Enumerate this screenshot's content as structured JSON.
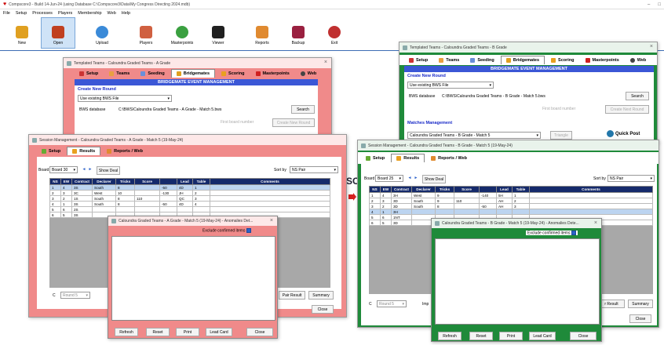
{
  "app": {
    "title": "Compscore3 - Build 14-Jun-24 (using Database C:\\Compscore3\\Data\\My Congress Directing 2024.mdb)",
    "window_controls": [
      "–",
      "□"
    ],
    "menu": [
      "File",
      "Setup",
      "Processes",
      "Players",
      "Membership",
      "Web",
      "Help"
    ],
    "toolbar": [
      {
        "label": "New",
        "icon": "new-icon",
        "color": "#e0a020"
      },
      {
        "label": "Open",
        "icon": "open-folder-icon",
        "color": "#c04020"
      },
      {
        "label": "Upload",
        "icon": "upload-cloud-icon",
        "color": "#3a8ad8"
      },
      {
        "label": "Players",
        "icon": "players-icon",
        "color": "#d06040"
      },
      {
        "label": "Masterpoints",
        "icon": "masterpoints-icon",
        "color": "#3aa040"
      },
      {
        "label": "Viewer",
        "icon": "viewer-icon",
        "color": "#202020"
      },
      {
        "label": "Reports",
        "icon": "reports-icon",
        "color": "#e08a30"
      },
      {
        "label": "Backup",
        "icon": "backup-icon",
        "color": "#9a2040"
      },
      {
        "label": "Exit",
        "icon": "exit-icon",
        "color": "#c03030"
      }
    ]
  },
  "colors": {
    "pink": "#f08a8a",
    "green": "#1f8a3a",
    "header_navy": "#152a6b",
    "bar_blue": "#3b57d6"
  },
  "templA": {
    "title": "Templated Teams - Caloundra Graded Teams - A Grade",
    "tabs": [
      "Setup",
      "Teams",
      "Seeding",
      "Bridgemates",
      "Scoring",
      "Masterpoints",
      "Web"
    ],
    "banner": "BRIDGEMATE EVENT MANAGEMENT",
    "create_heading": "Create New Round",
    "bws_select": "Use existing BWS File",
    "bws_label": "BWS database",
    "bws_path": "C:\\BWS\\Caloundra Graded Teams - A Grade - Match 5.bws",
    "search": "Search",
    "first_board": "First board number",
    "create_round": "Create New Round"
  },
  "templB": {
    "title": "Templated Teams - Caloundra Graded Teams - B Grade",
    "tabs": [
      "Setup",
      "Teams",
      "Seeding",
      "Bridgemates",
      "Scoring",
      "Masterpoints",
      "Web"
    ],
    "banner": "BRIDGEMATE EVENT MANAGEMENT",
    "create_heading": "Create New Round",
    "bws_select": "Use existing BWS File",
    "bws_label": "BWS database",
    "bws_path": "C:\\BWS\\Caloundra Graded Teams - B Grade - Match 5.bws",
    "search": "Search",
    "first_board": "First board number",
    "create_round": "Create Next Round",
    "matches_heading": "Matches Management",
    "match_select": "Caloundra Graded Teams - B Grade - Match 5",
    "triangle": "Triangle",
    "quick_post": "Quick Post"
  },
  "sessA": {
    "title": "Session Management - Caloundra Graded Teams - A Grade - Match 5 (19-May-24)",
    "tabs": [
      "Setup",
      "Results",
      "Reports / Web"
    ],
    "board_label": "Board",
    "board_value": "Board 30",
    "show_deal": "Show Deal",
    "sortby_label": "Sort by",
    "sortby_value": "NS Pair",
    "headers": [
      "NS",
      "EW",
      "Contract",
      "Declarer",
      "Tricks",
      "Score",
      "",
      "Lead",
      "Table",
      "Comments"
    ],
    "rows": [
      [
        "1",
        "4",
        "3S",
        "South",
        "8",
        "",
        "-50",
        "4D",
        "1",
        ""
      ],
      [
        "2",
        "3",
        "3C",
        "West",
        "10",
        "",
        "-130",
        "JH",
        "2",
        ""
      ],
      [
        "3",
        "2",
        "1S",
        "South",
        "8",
        "110",
        "",
        "QC",
        "3",
        ""
      ],
      [
        "4",
        "1",
        "3S",
        "South",
        "8",
        "",
        "-50",
        "4D",
        "4",
        ""
      ],
      [
        "5",
        "6",
        "2S",
        "",
        "",
        "",
        "",
        "",
        "",
        ""
      ],
      [
        "6",
        "5",
        "3S",
        "",
        "",
        "",
        "",
        "",
        "",
        ""
      ]
    ],
    "round_label": "C",
    "round_value": "Round 5",
    "pair_result": "Pair Result",
    "summary": "Summary",
    "close": "Close"
  },
  "sessB": {
    "title": "Session Management - Caloundra Graded Teams - B Grade - Match 5 (19-May-24)",
    "tabs": [
      "Setup",
      "Results",
      "Reports / Web"
    ],
    "board_label": "Board",
    "board_value": "Board 25",
    "show_deal": "Show Deal",
    "sortby_label": "Sort by",
    "sortby_value": "NS Pair",
    "headers": [
      "NS",
      "EW",
      "Contract",
      "Declarer",
      "Tricks",
      "Score",
      "",
      "Lead",
      "Table",
      "Comments"
    ],
    "rows": [
      [
        "1",
        "4",
        "3H",
        "West",
        "9",
        "",
        "-140",
        "5H",
        "1",
        ""
      ],
      [
        "2",
        "3",
        "3D",
        "South",
        "9",
        "110",
        "",
        "AH",
        "2",
        ""
      ],
      [
        "3",
        "2",
        "3D",
        "South",
        "8",
        "",
        "-50",
        "AH",
        "3",
        ""
      ],
      [
        "4",
        "1",
        "3H",
        "",
        "",
        "",
        "",
        "",
        "",
        ""
      ],
      [
        "5",
        "6",
        "1NT",
        "",
        "",
        "",
        "",
        "",
        "",
        ""
      ],
      [
        "6",
        "5",
        "3D",
        "",
        "",
        "",
        "",
        "",
        "",
        ""
      ]
    ],
    "round_label": "C",
    "round_value": "Round 5",
    "imp_partial": "Imp",
    "pair_result": "r Result",
    "summary": "Summary",
    "close": "Close"
  },
  "anomA": {
    "title": "Caloundra Graded Teams - A Grade - Match 5 (19-May-24) - Anomalies Det...",
    "exclude": "Exclude confirmed items",
    "buttons": [
      "Refresh",
      "Reset",
      "Print",
      "Lead Card",
      "Close"
    ]
  },
  "anomB": {
    "title": "Caloundra Graded Teams - B Grade - Match 5 (19-May-24) - Anomalies Dete...",
    "exclude": "Exclude confirmed items",
    "buttons": [
      "Refresh",
      "Reset",
      "Print",
      "Lead Card",
      "Close"
    ]
  },
  "bg_partial": "SC"
}
